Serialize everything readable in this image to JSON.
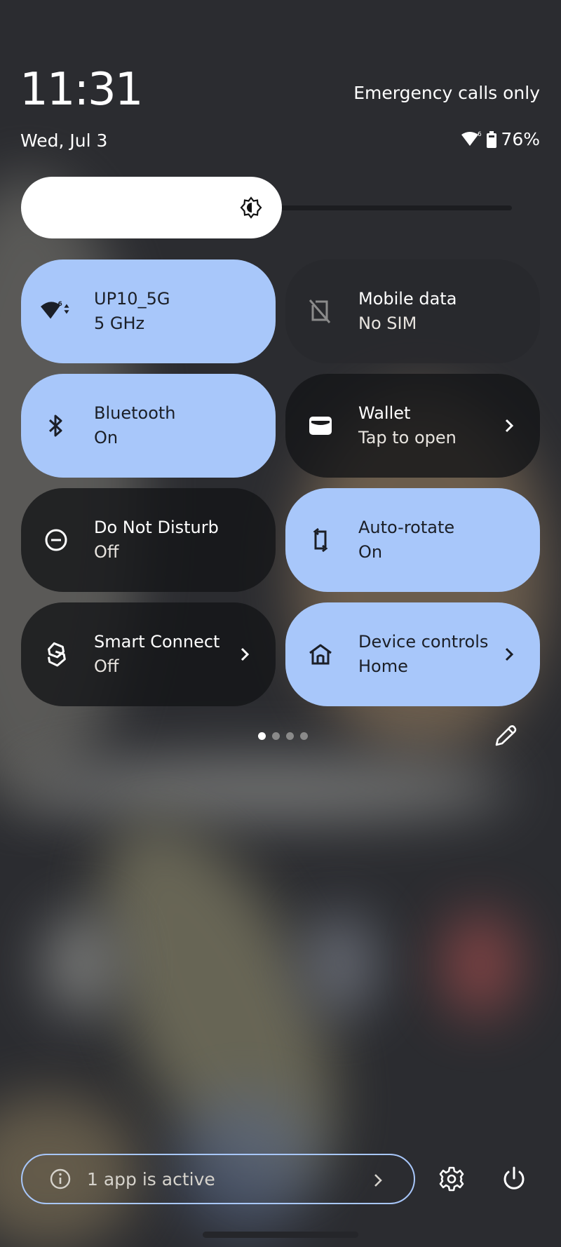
{
  "header": {
    "time": "11:31",
    "date": "Wed, Jul 3",
    "carrier_status": "Emergency calls only",
    "battery_percent": "76%",
    "status_icons": [
      "wifi-6-icon",
      "battery-icon"
    ]
  },
  "brightness": {
    "level_fraction": 0.5,
    "icon": "brightness-auto-icon"
  },
  "tiles": [
    {
      "id": "wifi",
      "title": "UP10_5G",
      "subtitle": "5 GHz",
      "state": "on",
      "icon": "wifi-6-icon",
      "has_chevron": false
    },
    {
      "id": "mobile-data",
      "title": "Mobile data",
      "subtitle": "No SIM",
      "state": "unavailable",
      "icon": "no-sim-icon",
      "has_chevron": false
    },
    {
      "id": "bluetooth",
      "title": "Bluetooth",
      "subtitle": "On",
      "state": "on",
      "icon": "bluetooth-icon",
      "has_chevron": false
    },
    {
      "id": "wallet",
      "title": "Wallet",
      "subtitle": "Tap to open",
      "state": "off",
      "icon": "wallet-icon",
      "has_chevron": true
    },
    {
      "id": "do-not-disturb",
      "title": "Do Not Disturb",
      "subtitle": "Off",
      "state": "off",
      "icon": "do-not-disturb-icon",
      "has_chevron": false
    },
    {
      "id": "auto-rotate",
      "title": "Auto-rotate",
      "subtitle": "On",
      "state": "on",
      "icon": "auto-rotate-icon",
      "has_chevron": false
    },
    {
      "id": "smart-connect",
      "title": "Smart Connect",
      "subtitle": "Off",
      "state": "off",
      "icon": "smart-connect-icon",
      "has_chevron": true
    },
    {
      "id": "device-controls",
      "title": "Device controls",
      "subtitle": "Home",
      "state": "on",
      "icon": "home-icon",
      "has_chevron": true
    }
  ],
  "pager": {
    "pages": 4,
    "current": 1
  },
  "footer": {
    "active_apps_label": "1 app is active",
    "settings_icon": "gear-icon",
    "power_icon": "power-icon"
  },
  "colors": {
    "tile_on": "#a8c7fa",
    "tile_off": "#141518",
    "accent_outline": "#a8c7fa"
  }
}
